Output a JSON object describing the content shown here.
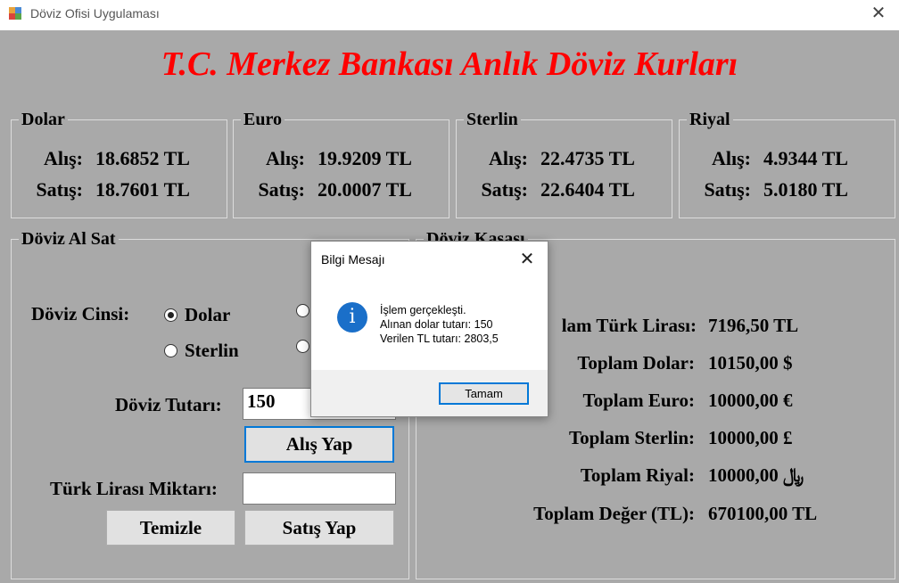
{
  "window": {
    "title": "Döviz Ofisi Uygulaması",
    "close_glyph": "✕"
  },
  "heading": "T.C. Merkez Bankası Anlık Döviz Kurları",
  "rates": {
    "buy_label": "Alış:",
    "sell_label": "Satış:",
    "currencies": [
      {
        "name": "Dolar",
        "buy": "18.6852 TL",
        "sell": "18.7601 TL"
      },
      {
        "name": "Euro",
        "buy": "19.9209 TL",
        "sell": "20.0007 TL"
      },
      {
        "name": "Sterlin",
        "buy": "22.4735 TL",
        "sell": "22.6404 TL"
      },
      {
        "name": "Riyal",
        "buy": "4.9344 TL",
        "sell": "5.0180 TL"
      }
    ]
  },
  "exchange": {
    "title": "Döviz Al Sat",
    "currency_type_label": "Döviz Cinsi:",
    "radio_options": [
      "Dolar",
      "Sterlin"
    ],
    "selected": "Dolar",
    "amount_label": "Döviz Tutarı:",
    "amount_value": "150",
    "buy_button": "Alış Yap",
    "tl_amount_label": "Türk Lirası Miktarı:",
    "tl_amount_value": "",
    "clear_button": "Temizle",
    "sell_button": "Satış Yap"
  },
  "vault": {
    "title": "Döviz Kasası",
    "rows": [
      {
        "label": "lam Türk Lirası:",
        "value": "7196,50 TL"
      },
      {
        "label": "Toplam Dolar:",
        "value": "10150,00 $"
      },
      {
        "label": "Toplam Euro:",
        "value": "10000,00 €"
      },
      {
        "label": "Toplam Sterlin:",
        "value": "10000,00 £"
      },
      {
        "label": "Toplam Riyal:",
        "value": "10000,00 ﷼"
      },
      {
        "label": "Toplam Değer (TL):",
        "value": "670100,00 TL"
      }
    ]
  },
  "dialog": {
    "title": "Bilgi Mesajı",
    "close_glyph": "✕",
    "icon_glyph": "i",
    "lines": [
      "İşlem gerçekleşti.",
      "Alınan dolar tutarı: 150",
      "Verilen TL tutarı: 2803,5"
    ],
    "ok_button": "Tamam"
  },
  "colors": {
    "background": "#a9a9a9",
    "heading": "#ff0000",
    "accent": "#0078d7",
    "info_icon": "#1a6fc9"
  }
}
